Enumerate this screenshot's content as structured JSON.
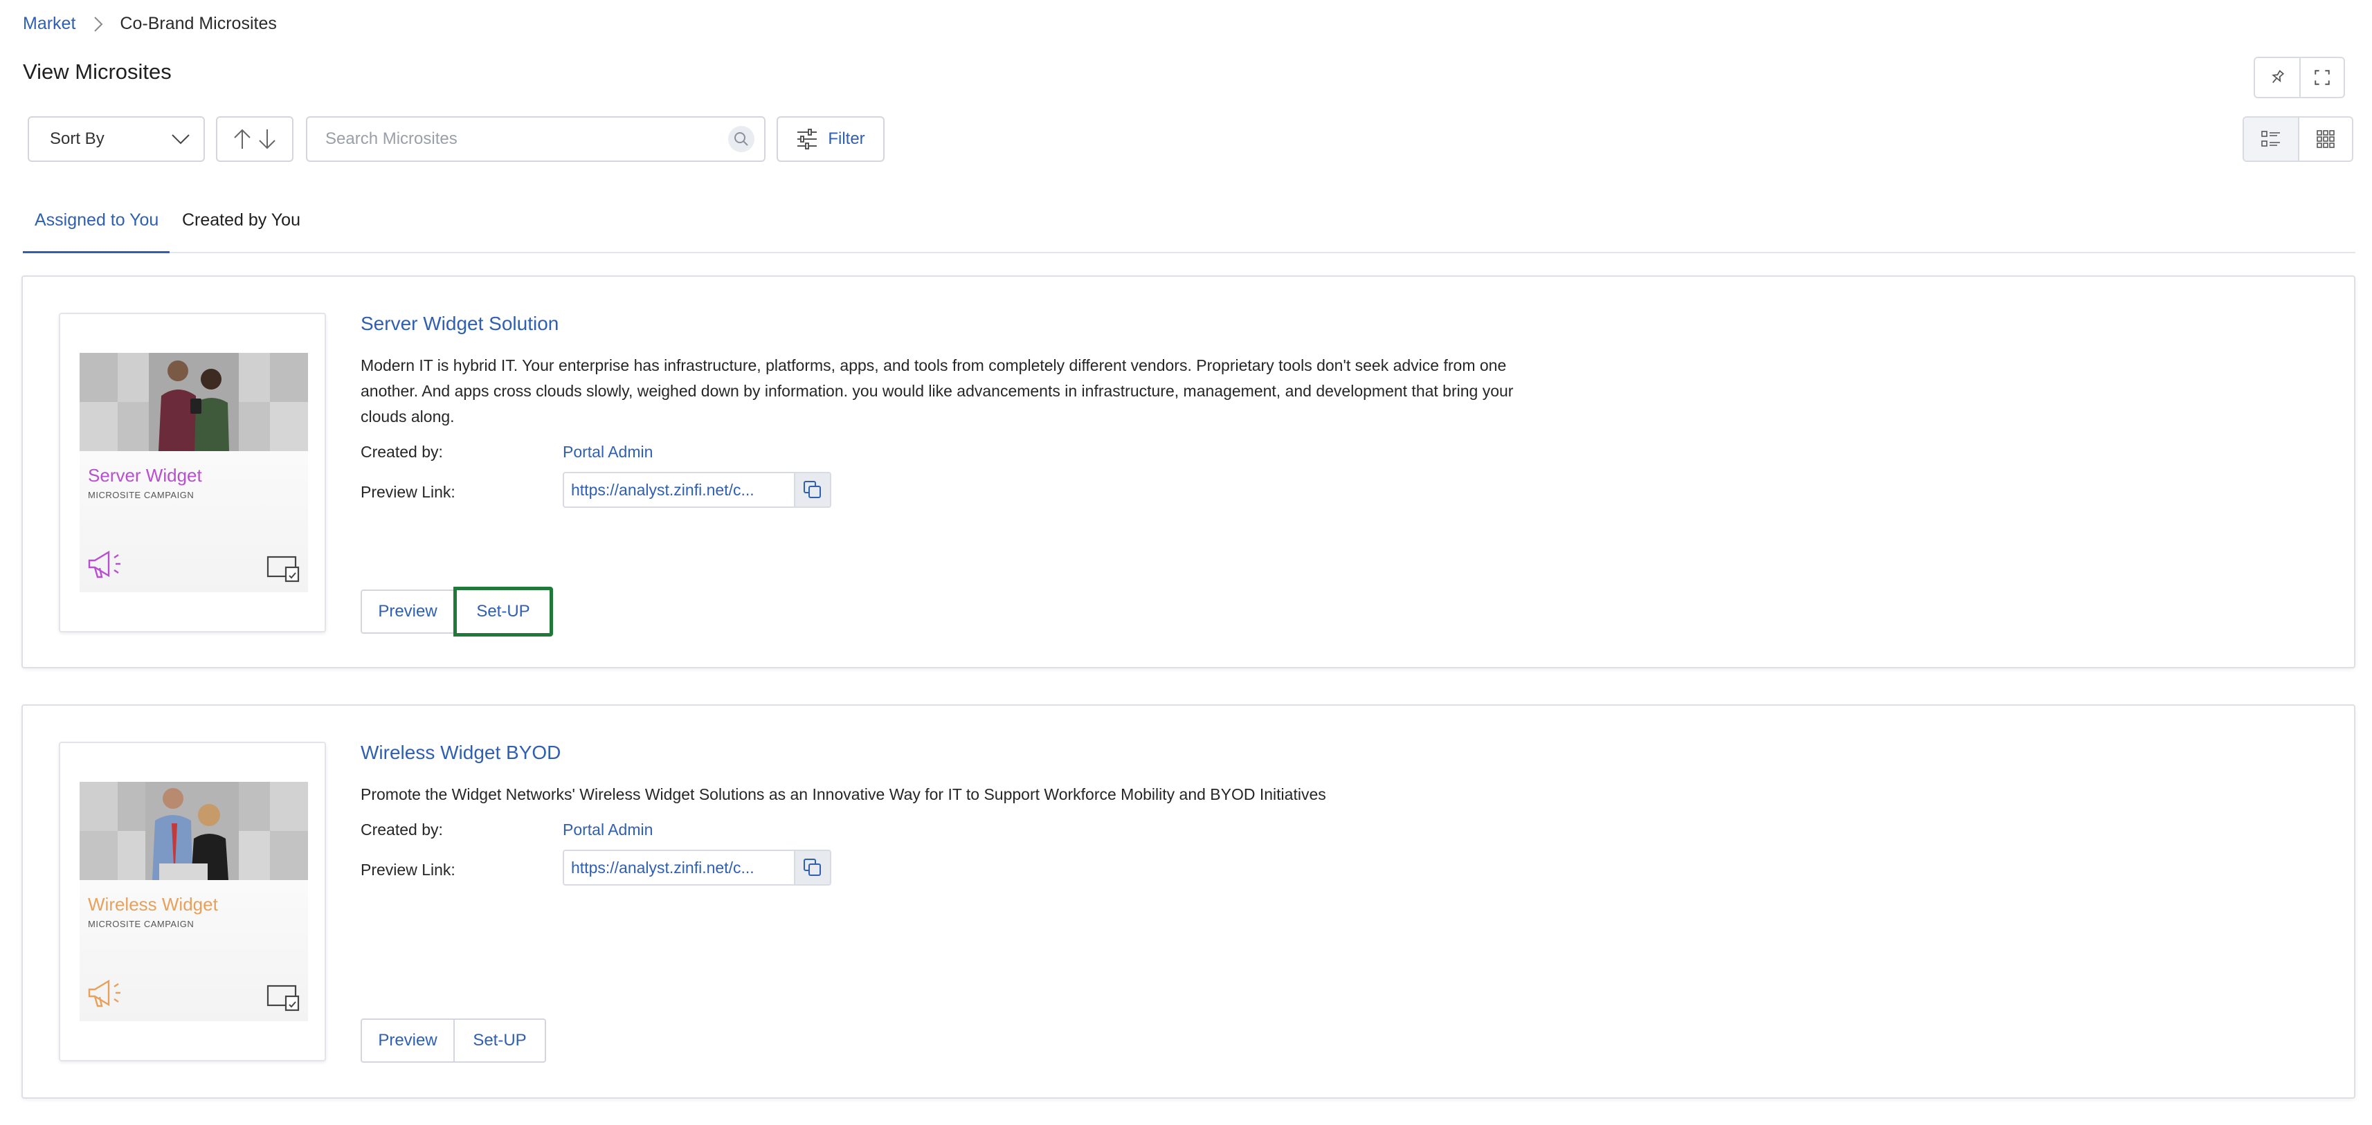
{
  "breadcrumb": {
    "root": "Market",
    "current": "Co-Brand Microsites"
  },
  "page": {
    "title": "View Microsites"
  },
  "toolbar": {
    "sort_label": "Sort By",
    "search_placeholder": "Search Microsites",
    "filter_label": "Filter"
  },
  "tabs": [
    {
      "label": "Assigned to You",
      "active": true
    },
    {
      "label": "Created by You",
      "active": false
    }
  ],
  "colors": {
    "link": "#2f5fb3",
    "focus_outline": "#1f7a3a",
    "server_accent": "#b84fd1",
    "wireless_accent": "#e8a15a"
  },
  "cards": [
    {
      "title": "Server Widget Solution",
      "description": "Modern IT is hybrid IT. Your enterprise has infrastructure, platforms, apps, and tools from completely different vendors. Proprietary tools don't seek advice from one another. And apps cross clouds slowly, weighed down by information. you would like advancements in infrastructure, management, and development that bring your clouds along.",
      "created_by_label": "Created by:",
      "created_by": "Portal Admin",
      "preview_link_label": "Preview Link:",
      "preview_link": "https://analyst.zinfi.net/c...",
      "thumb_title": "Server Widget",
      "thumb_subtitle": "MICROSITE CAMPAIGN",
      "preview_label": "Preview",
      "setup_label": "Set-UP"
    },
    {
      "title": "Wireless Widget BYOD",
      "description": "Promote the Widget Networks' Wireless Widget Solutions as an Innovative Way for IT to Support Workforce Mobility and BYOD Initiatives",
      "created_by_label": "Created by:",
      "created_by": "Portal Admin",
      "preview_link_label": "Preview Link:",
      "preview_link": "https://analyst.zinfi.net/c...",
      "thumb_title": "Wireless Widget",
      "thumb_subtitle": "MICROSITE CAMPAIGN",
      "preview_label": "Preview",
      "setup_label": "Set-UP"
    }
  ]
}
